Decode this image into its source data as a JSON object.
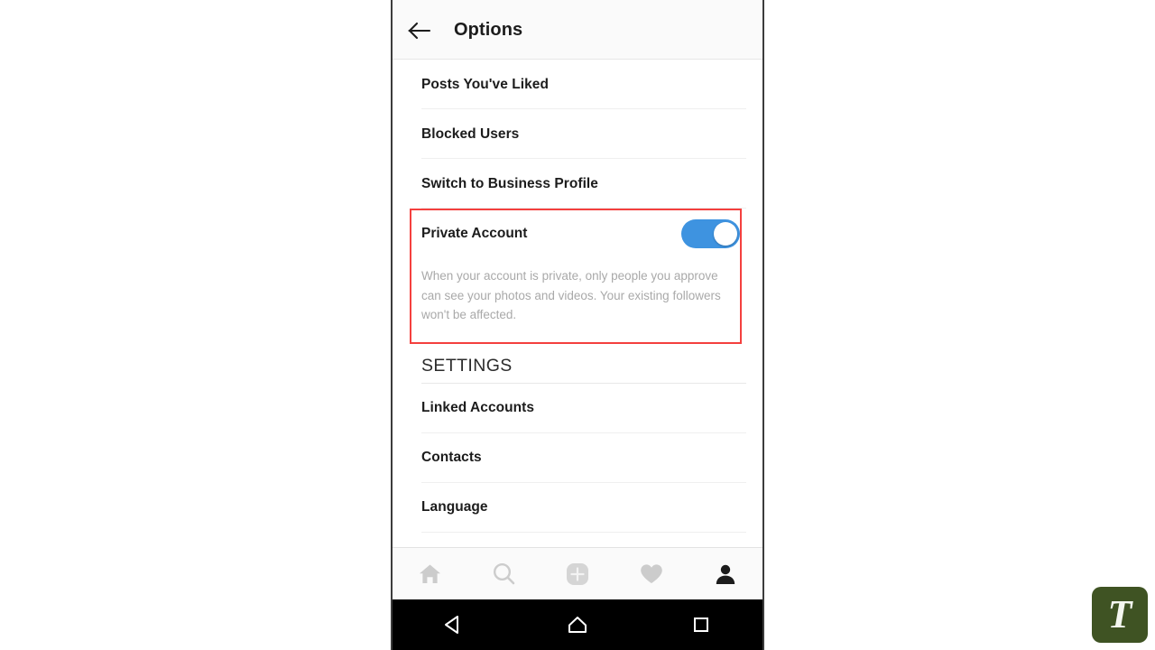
{
  "header": {
    "title": "Options",
    "back_icon": "arrow-left-icon"
  },
  "list_top": [
    {
      "label": "Posts You've Liked"
    },
    {
      "label": "Blocked Users"
    },
    {
      "label": "Switch to Business Profile"
    }
  ],
  "private_account": {
    "label": "Private Account",
    "toggle_state": "on",
    "toggle_color": "#3e93e0",
    "description": "When your account is private, only people you approve can see your photos and videos. Your existing followers won't be affected.",
    "highlight_color": "#f4403e"
  },
  "settings_section": {
    "header": "SETTINGS",
    "items": [
      {
        "label": "Linked Accounts"
      },
      {
        "label": "Contacts"
      },
      {
        "label": "Language"
      }
    ]
  },
  "tabbar": {
    "items": [
      {
        "icon": "home-icon",
        "active": false
      },
      {
        "icon": "search-icon",
        "active": false
      },
      {
        "icon": "add-post-icon",
        "active": false
      },
      {
        "icon": "heart-icon",
        "active": false
      },
      {
        "icon": "profile-icon",
        "active": true
      }
    ],
    "inactive_color": "#cccccc",
    "active_color": "#1c1c1c"
  },
  "system_nav": {
    "buttons": [
      {
        "icon": "back-triangle-icon"
      },
      {
        "icon": "home-pentagon-icon"
      },
      {
        "icon": "recents-square-icon"
      }
    ],
    "background": "#000000"
  },
  "watermark": {
    "letter": "T",
    "background": "#3f5323"
  }
}
